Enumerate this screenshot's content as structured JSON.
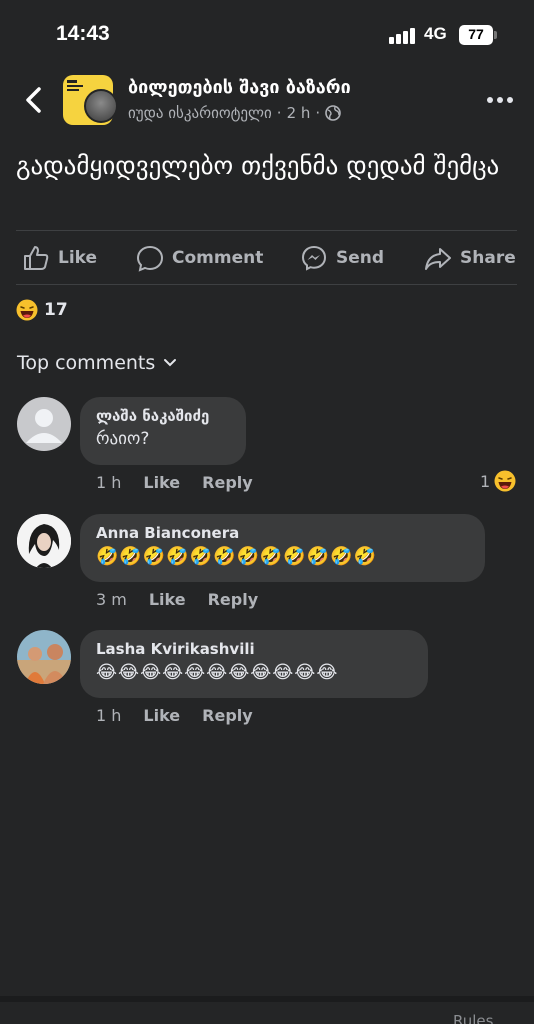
{
  "status_bar": {
    "time": "14:43",
    "network": "4G",
    "battery": "77"
  },
  "header": {
    "group_name": "ბილეთების შავი ბაზარი",
    "author": "იუდა ისკარიოტელი",
    "time_ago": "2 h",
    "separator": "·"
  },
  "post": {
    "text": "გადამყიდველებო თქვენმა დედამ შემცა"
  },
  "actions": {
    "like": "Like",
    "comment": "Comment",
    "send": "Send",
    "share": "Share"
  },
  "reactions": {
    "count": "17"
  },
  "top_comments_label": "Top comments",
  "comments": [
    {
      "name": "ლაშა ნაკაშიძე",
      "text": "რაიო?",
      "time": "1 h",
      "like": "Like",
      "reply": "Reply",
      "reaction_count": "1"
    },
    {
      "name": "Anna Bianconera",
      "text": "🤣🤣🤣🤣🤣🤣🤣🤣🤣🤣🤣🤣",
      "time": "3 m",
      "like": "Like",
      "reply": "Reply"
    },
    {
      "name": "Lasha Kvirikashvili",
      "text": "😂😂😂😂😂😂😂😂😂😂😂",
      "time": "1 h",
      "like": "Like",
      "reply": "Reply"
    }
  ],
  "footer": {
    "rules": "Rules"
  }
}
